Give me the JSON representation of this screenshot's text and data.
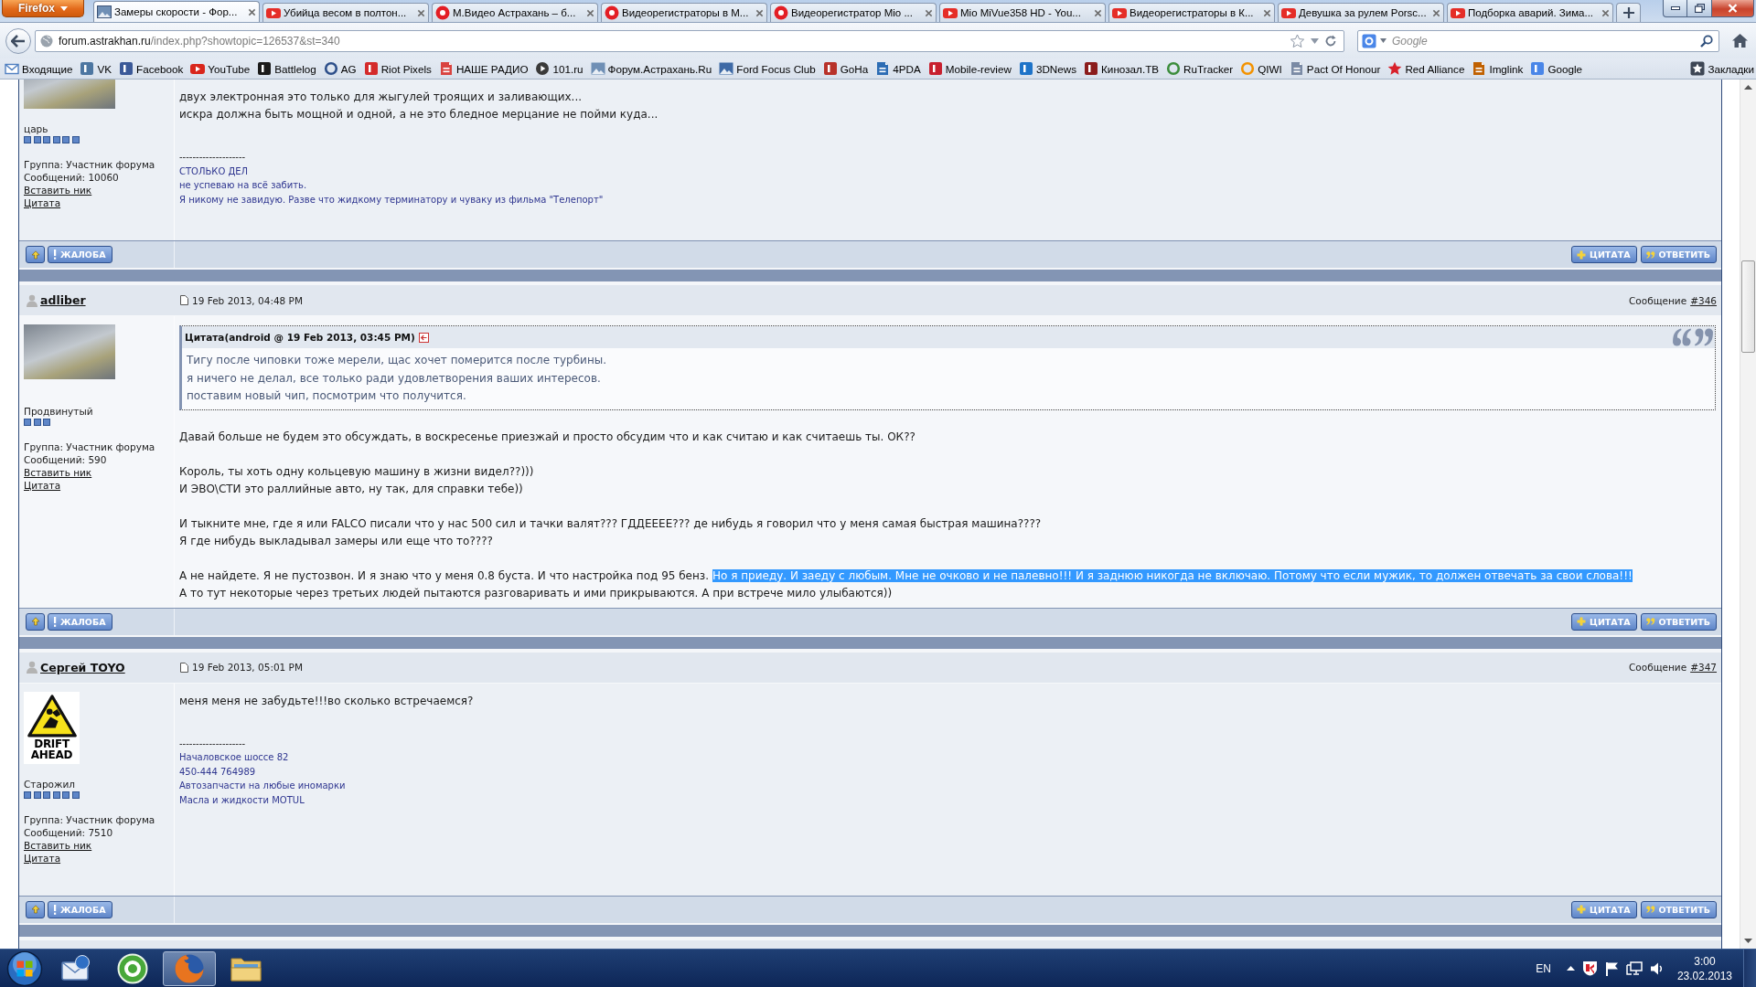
{
  "browser": {
    "menu_button": "Firefox",
    "tabs": [
      {
        "label": "Замеры скорости - Фор...",
        "kind": "picture",
        "selected": true
      },
      {
        "label": "Убийца весом в полтон...",
        "kind": "play",
        "selected": false
      },
      {
        "label": "М.Видео Астрахань – б...",
        "kind": "circle",
        "selected": false
      },
      {
        "label": "Видеорегистраторы в М...",
        "kind": "circle",
        "selected": false
      },
      {
        "label": "Видеорегистратор Mio ...",
        "kind": "circle",
        "selected": false
      },
      {
        "label": "Mio MiVue358 HD - You...",
        "kind": "play",
        "selected": false
      },
      {
        "label": "Видеорегистраторы в К...",
        "kind": "play",
        "selected": false
      },
      {
        "label": "Девушка за рулем Porsc...",
        "kind": "play",
        "selected": false
      },
      {
        "label": "Подборка аварий. Зима...",
        "kind": "play",
        "selected": false
      }
    ],
    "address_bar": {
      "host": "forum.astrakhan.ru",
      "path": "/index.php?showtopic=126537&st=340"
    },
    "search": {
      "placeholder": "Google"
    },
    "bookmarks": [
      {
        "label": "Входящие",
        "kind": "envelope",
        "color": "#4f7fc0"
      },
      {
        "label": "VK",
        "kind": "tile",
        "color": "#4d76a1"
      },
      {
        "label": "Facebook",
        "kind": "tile",
        "color": "#3b5998"
      },
      {
        "label": "YouTube",
        "kind": "play",
        "color": "#d9261c"
      },
      {
        "label": "Battlelog",
        "kind": "tile",
        "color": "#1a1a1a"
      },
      {
        "label": "AG",
        "kind": "ring",
        "color": "#2d4f8a"
      },
      {
        "label": "Riot Pixels",
        "kind": "tile",
        "color": "#d42a2a"
      },
      {
        "label": "НАШЕ РАДИО",
        "kind": "page",
        "color": "#d9433f"
      },
      {
        "label": "101.ru",
        "kind": "disc",
        "color": "#3a3a3a"
      },
      {
        "label": "Форум.Астрахань.Ru",
        "kind": "picture",
        "color": "#6f8fb5"
      },
      {
        "label": "Ford Focus Club",
        "kind": "picture",
        "color": "#3f6aa6"
      },
      {
        "label": "GoHa",
        "kind": "tile",
        "color": "#b8322a"
      },
      {
        "label": "4PDA",
        "kind": "page",
        "color": "#2c6cb4"
      },
      {
        "label": "Mobile-review",
        "kind": "tile",
        "color": "#c8202f"
      },
      {
        "label": "3DNews",
        "kind": "tile",
        "color": "#1e73c8"
      },
      {
        "label": "Кинозал.ТВ",
        "kind": "tile",
        "color": "#8b1c1c"
      },
      {
        "label": "RuTracker",
        "kind": "ring",
        "color": "#3c8d3c"
      },
      {
        "label": "QIWI",
        "kind": "ring",
        "color": "#f39200"
      },
      {
        "label": "Pact Of Honour",
        "kind": "page",
        "color": "#7a8aa5"
      },
      {
        "label": "Red Alliance",
        "kind": "star",
        "color": "#d8202a"
      },
      {
        "label": "Imglink",
        "kind": "page",
        "color": "#c06000"
      },
      {
        "label": "Google",
        "kind": "tile",
        "color": "#4a86e8"
      }
    ],
    "bookmarks_menu": "Закладки"
  },
  "posts": [
    {
      "rank": "царь",
      "stars": 6,
      "avatar": {
        "kind": "photo"
      },
      "group": "Группа: Участник форума",
      "count": "Сообщений: 10060",
      "links": [
        "Вставить ник",
        "Цитата"
      ],
      "body": [
        [
          [
            {
              "text": "двух электронная это только для жыгулей троящих и заливающих...",
              "selected": false
            }
          ],
          [
            {
              "text": "искра должна быть мощной и одной, а не это бледное мерцание не пойми куда...",
              "selected": false
            }
          ]
        ]
      ],
      "signature_divider": "--------------------",
      "signature": [
        "СТОЛЬКО ДЕЛ",
        "не успеваю на всё забить.",
        "Я никому не завидую. Разве что жидкому терминатору и чуваку из фильма \"Телепорт\""
      ],
      "buttons": [
        {
          "kind": "top"
        },
        {
          "kind": "report",
          "label": "ЖАЛОБА"
        },
        {
          "kind": "quote",
          "label": "ЦИТАТА"
        },
        {
          "kind": "reply",
          "label": "ОТВЕТИТЬ"
        }
      ]
    },
    {
      "author": "adliber",
      "date": "19 Feb 2013, 04:48 PM",
      "post_label": "Сообщение",
      "post_number": "#346",
      "rank": "Продвинутый",
      "stars": 3,
      "avatar": {
        "kind": "photo"
      },
      "group": "Группа: Участник форума",
      "count": "Сообщений: 590",
      "links": [
        "Вставить ник",
        "Цитата"
      ],
      "quote": {
        "title": "Цитата(android @ 19 Feb 2013, 03:45 PM)",
        "lines": [
          "Тигу после чиповки тоже мерели, щас хочет померится после турбины.",
          "я ничего не делал, все только ради удовлетворения ваших интересов.",
          "поставим новый чип, посмотрим что получится."
        ]
      },
      "body": [
        [
          [
            {
              "text": "Давай больше не будем это обсуждать, в воскресенье приезжай и просто обсудим что и как считаю и как считаешь ты. ОК??",
              "selected": false
            }
          ]
        ],
        [
          [
            {
              "text": "Король, ты хоть одну кольцевую машину в жизни видел??)))",
              "selected": false
            }
          ],
          [
            {
              "text": "И ЭВО\\СТИ это раллийные авто, ну так, для справки тебе))",
              "selected": false
            }
          ]
        ],
        [
          [
            {
              "text": "И тыкните мне, где я или FALCO писали что у нас 500 сил и тачки валят??? ГДДЕЕЕЕ??? де нибудь я говорил что у меня самая быстрая машина????",
              "selected": false
            }
          ],
          [
            {
              "text": "Я где нибудь выкладывал замеры или еще что то????",
              "selected": false
            }
          ]
        ],
        [
          [
            {
              "text": "А не найдете. Я не пустозвон. И я знаю что у меня 0.8 буста. И что настройка под 95 бенз.",
              "selected": false
            },
            {
              "text": "Но я приеду. И заеду с любым. Мне не очково и не палевно!!! И я заднюю никогда не включаю. Потому что если мужик, то должен отвечать за свои слова!!!",
              "selected": true
            }
          ],
          [
            {
              "text": "А то тут некоторые через третьих людей пытаются разговаривать и ими прикрываются. А при встрече мило улыбаются))",
              "selected": false
            }
          ]
        ]
      ],
      "buttons": [
        {
          "kind": "top"
        },
        {
          "kind": "report",
          "label": "ЖАЛОБА"
        },
        {
          "kind": "quote",
          "label": "ЦИТАТА"
        },
        {
          "kind": "reply",
          "label": "ОТВЕТИТЬ"
        }
      ]
    },
    {
      "author": "Сергей TOYO",
      "date": "19 Feb 2013, 05:01 PM",
      "post_label": "Сообщение",
      "post_number": "#347",
      "rank": "Старожил",
      "stars": 6,
      "avatar": {
        "kind": "sign",
        "caption": "DRIFT AHEAD"
      },
      "group": "Группа: Участник форума",
      "count": "Сообщений: 7510",
      "links": [
        "Вставить ник",
        "Цитата"
      ],
      "body": [
        [
          [
            {
              "text": "меня меня не забудьте!!!во сколько встречаемся?",
              "selected": false
            }
          ]
        ]
      ],
      "signature_divider": "--------------------",
      "signature": [
        "Началовское шоссе 82",
        "450-444 764989",
        "Автозапчасти на любые иномарки",
        "Масла и жидкости MOTUL"
      ],
      "buttons": [
        {
          "kind": "top"
        },
        {
          "kind": "report",
          "label": "ЖАЛОБА"
        },
        {
          "kind": "quote",
          "label": "ЦИТАТА"
        },
        {
          "kind": "reply",
          "label": "ОТВЕТИТЬ"
        }
      ]
    }
  ],
  "taskbar": {
    "apps": [
      {
        "kind": "mail",
        "selected": false
      },
      {
        "kind": "torrent",
        "selected": false
      },
      {
        "kind": "browser",
        "selected": true
      },
      {
        "kind": "folder",
        "selected": false
      }
    ],
    "language": "EN",
    "time": "3:00",
    "date": "23.02.2013"
  }
}
